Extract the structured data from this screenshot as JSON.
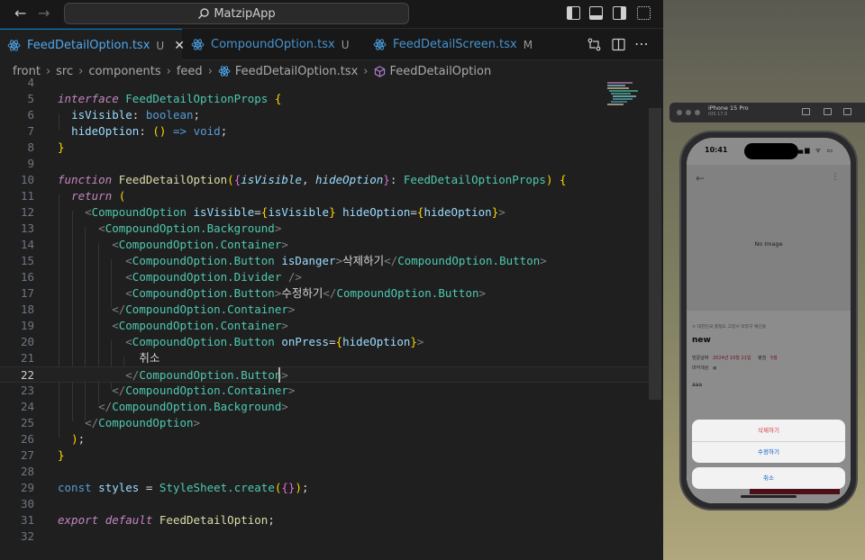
{
  "titlebar": {
    "search_text": "MatzipApp"
  },
  "tabs": [
    {
      "label": "FeedDetailOption.tsx",
      "status": "U",
      "active": true
    },
    {
      "label": "CompoundOption.tsx",
      "status": "U",
      "active": false
    },
    {
      "label": "FeedDetailScreen.tsx",
      "status": "M",
      "active": false
    }
  ],
  "tab_close_glyph": "✕",
  "breadcrumb": {
    "parts": [
      "front",
      "src",
      "components",
      "feed",
      "FeedDetailOption.tsx",
      "FeedDetailOption"
    ],
    "separator": "›"
  },
  "editor": {
    "current_line": 22,
    "line_numbers": [
      "4",
      "5",
      "6",
      "7",
      "8",
      "9",
      "10",
      "11",
      "12",
      "13",
      "14",
      "15",
      "16",
      "17",
      "18",
      "19",
      "20",
      "21",
      "22",
      "23",
      "24",
      "25",
      "26",
      "27",
      "28",
      "29",
      "30",
      "31",
      "32"
    ],
    "code": {
      "l5": "interface FeedDetailOptionProps {",
      "l6": "  isVisible: boolean;",
      "l7": "  hideOption: () => void;",
      "l8": "}",
      "l10": "function FeedDetailOption({isVisible, hideOption}: FeedDetailOptionProps) {",
      "l11": "  return (",
      "l12": "    <CompoundOption isVisible={isVisible} hideOption={hideOption}>",
      "l13": "      <CompoundOption.Background>",
      "l14": "        <CompoundOption.Container>",
      "l15": "          <CompoundOption.Button isDanger>삭제하기</CompoundOption.Button>",
      "l16": "          <CompoundOption.Divider />",
      "l17": "          <CompoundOption.Button>수정하기</CompoundOption.Button>",
      "l18": "        </CompoundOption.Container>",
      "l19": "        <CompoundOption.Container>",
      "l20": "          <CompoundOption.Button onPress={hideOption}>",
      "l21": "            취소",
      "l22": "          </CompoundOption.Button>",
      "l23": "        </CompoundOption.Container>",
      "l24": "      </CompoundOption.Background>",
      "l25": "    </CompoundOption>",
      "l26": "  );",
      "l27": "}",
      "l29": "const styles = StyleSheet.create({});",
      "l31": "export default FeedDetailOption;"
    }
  },
  "simulator": {
    "device_name": "iPhone 15 Pro",
    "os_version": "iOS 17.0",
    "status_time": "10:41",
    "status_icons": "▂▄▆ ᯤ ▭",
    "image_placeholder": "No Image",
    "address": "⊙ 대한민국 충청도 고양시 덕양구 예인동",
    "feed_title": "new",
    "visit_label": "방문날짜",
    "visit_date": "2024년 10월 21일",
    "score_label": "평점",
    "score_value": "5점",
    "marker_label": "마커색상",
    "marker_value": "●",
    "description": "aaa",
    "option_delete": "삭제하기",
    "option_edit": "수정하기",
    "option_cancel": "취소",
    "danger_color": "#d93a4a",
    "action_color": "#0a58ca"
  },
  "colors": {
    "accent": "#0078d4",
    "tab_text": "#4fa8ee"
  }
}
